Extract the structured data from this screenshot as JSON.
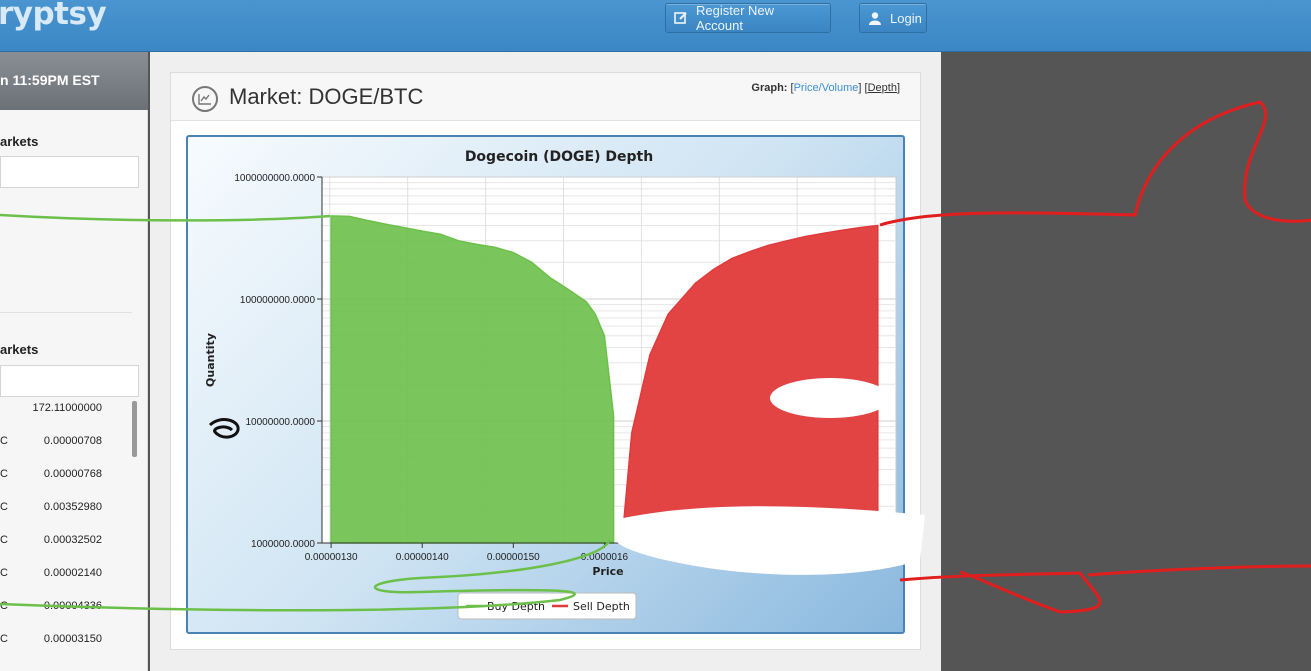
{
  "brand": {
    "logo_text": "ryptsy"
  },
  "nav": {
    "register_label": "Register New Account",
    "login_label": "Login"
  },
  "sidebar": {
    "clock": "n 11:59PM EST",
    "section1_title": "arkets",
    "section2_title": "arkets",
    "markets": [
      {
        "pair": "",
        "value": "172.11000000"
      },
      {
        "pair": "C",
        "value": "0.00000708"
      },
      {
        "pair": "C",
        "value": "0.00000768"
      },
      {
        "pair": "C",
        "value": "0.00352980"
      },
      {
        "pair": "C",
        "value": "0.00032502"
      },
      {
        "pair": "C",
        "value": "0.00002140"
      },
      {
        "pair": "C",
        "value": "0.00004336"
      },
      {
        "pair": "C",
        "value": "0.00003150"
      }
    ]
  },
  "market": {
    "title": "Market: DOGE/BTC",
    "graph_label": "Graph:",
    "graph_options": [
      "Price/Volume",
      "Depth"
    ],
    "active_graph": "Depth"
  },
  "colors": {
    "buy": "#6cc04a",
    "sell": "#e03a3a",
    "accent": "#3b87c5"
  },
  "chart_data": {
    "type": "area",
    "title": "Dogecoin (DOGE) Depth",
    "xlabel": "Price",
    "ylabel": "Quantity",
    "y_scale": "log",
    "ylim": [
      1000000,
      1000000000
    ],
    "y_ticks": [
      "1000000.0000",
      "10000000.0000",
      "100000000.0000",
      "1000000000.0000"
    ],
    "y_tick_values": [
      1000000,
      10000000,
      100000000,
      1000000000
    ],
    "x_ticks": [
      "0.00000130",
      "0.00000140",
      "0.00000150",
      "0.0000016"
    ],
    "x_tick_values": [
      1.3e-06,
      1.4e-06,
      1.5e-06,
      1.6e-06
    ],
    "xlim": [
      1.29e-06,
      1.92e-06
    ],
    "legend": [
      "Buy Depth",
      "Sell Depth"
    ],
    "legend_position": "bottom",
    "series": [
      {
        "name": "Buy Depth",
        "x": [
          1.3e-06,
          1.32e-06,
          1.34e-06,
          1.36e-06,
          1.38e-06,
          1.4e-06,
          1.42e-06,
          1.44e-06,
          1.46e-06,
          1.48e-06,
          1.5e-06,
          1.52e-06,
          1.54e-06,
          1.56e-06,
          1.58e-06,
          1.59e-06,
          1.6e-06,
          1.61e-06
        ],
        "y": [
          480000000,
          475000000,
          440000000,
          410000000,
          385000000,
          360000000,
          340000000,
          300000000,
          280000000,
          265000000,
          240000000,
          200000000,
          150000000,
          120000000,
          95000000,
          75000000,
          50000000,
          11000000
        ]
      },
      {
        "name": "Sell Depth",
        "x": [
          1.62e-06,
          1.63e-06,
          1.65e-06,
          1.67e-06,
          1.7e-06,
          1.72e-06,
          1.74e-06,
          1.76e-06,
          1.78e-06,
          1.8e-06,
          1.82e-06,
          1.84e-06,
          1.86e-06,
          1.88e-06,
          1.9e-06
        ],
        "y": [
          1200000,
          8000000,
          35000000,
          75000000,
          135000000,
          175000000,
          215000000,
          245000000,
          275000000,
          300000000,
          325000000,
          345000000,
          365000000,
          385000000,
          400000000
        ]
      }
    ]
  }
}
